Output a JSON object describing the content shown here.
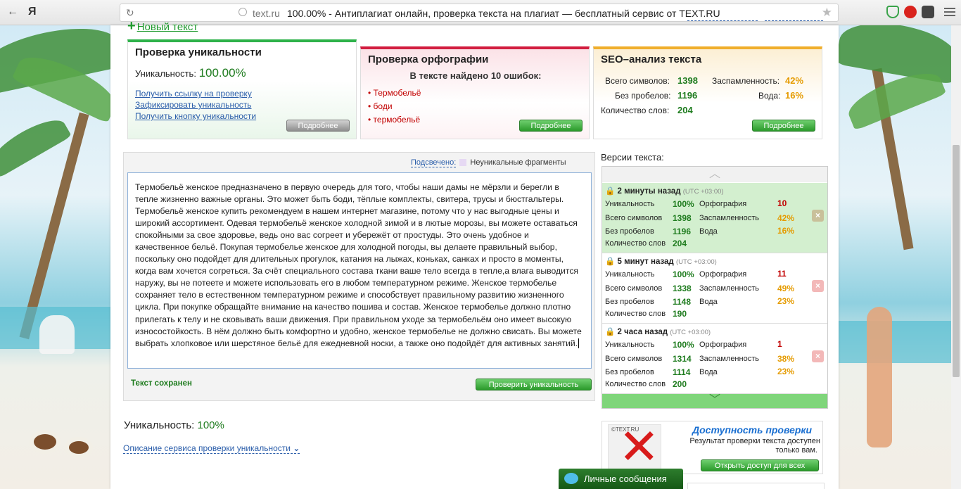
{
  "browser": {
    "back": "←",
    "logo": "Я",
    "reload": "↻",
    "host": "text.ru",
    "title": "100.00% - Антиплагиат онлайн, проверка текста на плагиат — бесплатный сервис от TEXT.RU",
    "star": "★"
  },
  "header": {
    "new_text_link": "Новый текст"
  },
  "uniq_block": {
    "title": "Проверка уникальности",
    "label": "Уникальность:",
    "value": "100.00%",
    "links": [
      "Получить ссылку на проверку",
      "Зафиксировать уникальность",
      "Получить кнопку уникальности"
    ],
    "more_button": "Подробнее"
  },
  "spell_block": {
    "title": "Проверка орфографии",
    "subtitle": "В тексте найдено 10 ошибок:",
    "errors": [
      "Термобельё",
      "боди",
      "термобельё"
    ],
    "more_button": "Подробнее"
  },
  "seo_block": {
    "title": "SEO–анализ текста",
    "total_chars_label": "Всего символов:",
    "total_chars": "1398",
    "no_spaces_label": "Без пробелов:",
    "no_spaces": "1196",
    "words_label": "Количество слов:",
    "words": "204",
    "spam_label": "Заспамленность:",
    "spam": "42%",
    "water_label": "Вода:",
    "water": "16%",
    "more_button": "Подробнее"
  },
  "editor": {
    "highlight_link": "Подсвечено:",
    "highlight_legend": "Неуникальные фрагменты",
    "text": "Термобельё женское предназначено в первую очередь для того, чтобы наши дамы не мёрзли и берегли в тепле жизненно важные органы. Это может быть боди, тёплые комплекты, свитера, трусы и бюстгальтеры. Термобельё женское купить рекомендуем в нашем интернет магазине, потому что у нас выгодные цены и широкий ассортимент. Одевая термобельё женское холодной зимой и в лютые морозы, вы можете оставаться спокойными за свое здоровье, ведь оно вас согреет и убережёт от простуды. Это очень удобное и качественное бельё. Покупая термобелье женское для холодной погоды, вы делаете правильный выбор, поскольку оно подойдет для длительных прогулок, катания на лыжах, коньках, санках и просто в моменты, когда вам хочется согреться. За счёт специального состава ткани ваше тело всегда в тепле,а влага выводится наружу, вы не потеете и можете использовать его в любом температурном режиме. Женское термобелье сохраняет тело в естественном температурном режиме и способствует правильному развитию жизненного цикла. При покупке обращайте внимание на качество пошива и состав. Женское термобелье должно плотно прилегать к телу и не сковывать ваши движения. При правильном уходе за термобельём оно имеет высокую износостойкость. В нём должно быть комфортно и удобно, женское термобелье не должно свисать. Вы можете выбрать хлопковое или шерстяное бельё для ежедневной носки, а также оно подойдёт для активных занятий.",
    "saved_status": "Текст сохранен",
    "check_button": "Проверить уникальность"
  },
  "result": {
    "label": "Уникальность:",
    "value": "100%",
    "description_link": "Описание сервиса проверки уникальности"
  },
  "versions": {
    "title": "Версии текста:",
    "labels": {
      "uniq": "Уникальность",
      "total": "Всего символов",
      "nospace": "Без пробелов",
      "words": "Количество слов",
      "spell": "Орфография",
      "spam": "Заспамленность",
      "water": "Вода"
    },
    "items": [
      {
        "time": "2 минуты назад",
        "utc": "(UTC +03:00)",
        "uniq": "100%",
        "total": "1398",
        "nospace": "1196",
        "words": "204",
        "spell": "10",
        "spam": "42%",
        "water": "16%",
        "delete": "×"
      },
      {
        "time": "5 минут назад",
        "utc": "(UTC +03:00)",
        "uniq": "100%",
        "total": "1338",
        "nospace": "1148",
        "words": "190",
        "spell": "11",
        "spam": "49%",
        "water": "23%",
        "delete": "×"
      },
      {
        "time": "2 часа назад",
        "utc": "(UTC +03:00)",
        "uniq": "100%",
        "total": "1314",
        "nospace": "1114",
        "words": "200",
        "spell": "1",
        "spam": "38%",
        "water": "23%",
        "delete": "×"
      }
    ]
  },
  "access": {
    "logo_text": "©TEXT.RU",
    "title": "Доступность проверки",
    "text_line1": "Результат проверки текста доступен",
    "text_line2": "только вам.",
    "button": "Открыть доступ для всех"
  },
  "messages": {
    "label": "Личные сообщения"
  },
  "colors": {
    "accent_green": "#1f7c1f",
    "error_red": "#c20000",
    "warning_orange": "#e59b00",
    "link_blue": "#2a5daa"
  }
}
